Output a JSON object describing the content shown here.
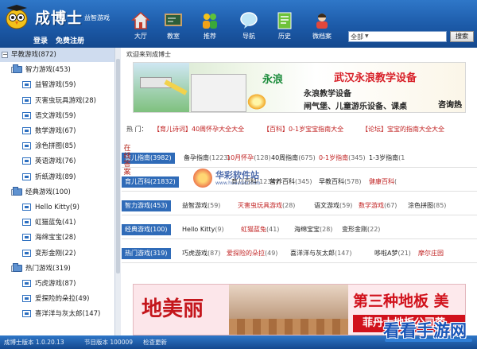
{
  "app": {
    "title": "成博士",
    "subtitle": "益智游戏",
    "login": "登录",
    "register": "免费注册"
  },
  "nav": [
    {
      "label": "大厅",
      "icon": "home-icon"
    },
    {
      "label": "教室",
      "icon": "blackboard-icon"
    },
    {
      "label": "推荐",
      "icon": "people-icon"
    },
    {
      "label": "导航",
      "icon": "speech-bubble-icon"
    },
    {
      "label": "历史",
      "icon": "history-icon"
    },
    {
      "label": "微档案",
      "icon": "profile-icon"
    }
  ],
  "search": {
    "scope": "全部",
    "button": "搜索"
  },
  "sidebar": {
    "items": [
      {
        "label": "早教游戏(872)",
        "level": 0,
        "type": "root"
      },
      {
        "label": "智力游戏(453)",
        "level": 1,
        "type": "folder"
      },
      {
        "label": "益智游戏(59)",
        "level": 2,
        "type": "game"
      },
      {
        "label": "灭害虫玩具游戏(28)",
        "level": 2,
        "type": "game"
      },
      {
        "label": "语文游戏(59)",
        "level": 2,
        "type": "game"
      },
      {
        "label": "数学游戏(67)",
        "level": 2,
        "type": "game"
      },
      {
        "label": "涂色拼图(85)",
        "level": 2,
        "type": "game"
      },
      {
        "label": "英语游戏(76)",
        "level": 2,
        "type": "game"
      },
      {
        "label": "折纸游戏(89)",
        "level": 2,
        "type": "game"
      },
      {
        "label": "经典游戏(100)",
        "level": 1,
        "type": "folder"
      },
      {
        "label": "Hello Kitty(9)",
        "level": 2,
        "type": "game"
      },
      {
        "label": "虹猫蓝兔(41)",
        "level": 2,
        "type": "game"
      },
      {
        "label": "海绵宝宝(28)",
        "level": 2,
        "type": "game"
      },
      {
        "label": "变形金刚(22)",
        "level": 2,
        "type": "game"
      },
      {
        "label": "热门游戏(319)",
        "level": 1,
        "type": "folder"
      },
      {
        "label": "巧虎游戏(87)",
        "level": 2,
        "type": "game"
      },
      {
        "label": "爱探险的朵拉(49)",
        "level": 2,
        "type": "game"
      },
      {
        "label": "喜洋洋与灰太郎(147)",
        "level": 2,
        "type": "game"
      }
    ]
  },
  "content": {
    "welcome": "欢迎来到成博士",
    "banner": {
      "logo_text": "永浪",
      "headline": "武汉永浪教学设备",
      "line1": "永浪教学设备",
      "line2": "闸气堡、儿童游乐设备、课桌",
      "consult": "咨询热"
    },
    "hot_label": "热  门：",
    "hot_links": [
      "【育儿诗词】40周怀孕大全大全",
      "【百科】0-1岁宝宝指南大全",
      "【论坛】宝宝的指南大全大全"
    ],
    "vertical_tab": "在线答案",
    "categories": [
      {
        "tag": "育儿指南(3982)",
        "links": [
          {
            "name": "备孕指南",
            "num": "(1223)"
          },
          {
            "name": "10月怀孕",
            "num": "(128)",
            "red": true
          },
          {
            "name": "40周指南",
            "num": "(675)"
          },
          {
            "name": "0-1岁指南",
            "num": "(345)",
            "red": true
          },
          {
            "name": "1-3岁指南",
            "num": "(1"
          }
        ]
      },
      {
        "tag": "育儿百科(21832)",
        "links": [
          {
            "name": "",
            "num": ""
          },
          {
            "name": "育儿百科",
            "num": "(1234)"
          },
          {
            "name": "营养百科",
            "num": "(345)"
          },
          {
            "name": "早教百科",
            "num": "(578)"
          },
          {
            "name": "健康百科",
            "num": "(",
            "red": true
          }
        ]
      },
      {
        "tag": "智力游戏(453)",
        "links": [
          {
            "name": "益智游戏",
            "num": "(59)"
          },
          {
            "name": "灭害虫玩具游戏",
            "num": "(28)",
            "red": true
          },
          {
            "name": "语文游戏",
            "num": "(59)"
          },
          {
            "name": "数学游戏",
            "num": "(67)",
            "red": true
          },
          {
            "name": "涂色拼图",
            "num": "(85)"
          }
        ]
      },
      {
        "tag": "经典游戏(100)",
        "links": [
          {
            "name": "Hello Kitty",
            "num": "(9)"
          },
          {
            "name": "虹猫蓝兔",
            "num": "(41)",
            "red": true
          },
          {
            "name": "海绵宝宝",
            "num": "(28)"
          },
          {
            "name": "变形金刚",
            "num": "(22)"
          }
        ]
      },
      {
        "tag": "热门游戏(319)",
        "links": [
          {
            "name": "巧虎游戏",
            "num": "(87)"
          },
          {
            "name": "爱探险的朵拉",
            "num": "(49)",
            "red": true
          },
          {
            "name": "喜洋洋与灰太郎",
            "num": "(147)"
          },
          {
            "name": "哆啦A梦",
            "num": "(21)"
          },
          {
            "name": "摩尔庄园",
            "num": "",
            "red": true
          }
        ]
      }
    ],
    "watermark": {
      "text": "华彩软件站",
      "url": "www.huacolor.com"
    },
    "bottom_banner": {
      "left": "地美丽",
      "right": "第三种地板 美",
      "right_sub": "菲丹士地板公司荣"
    }
  },
  "status": {
    "version": "成博士版本 1.0.20.13",
    "node": "节目版本 100009",
    "check": "检查更新"
  },
  "site_logo": "看看手游网",
  "colors": {
    "header_blue": "#1c5aa8",
    "tag_blue": "#2f6bb8",
    "link_red": "#c02020"
  }
}
